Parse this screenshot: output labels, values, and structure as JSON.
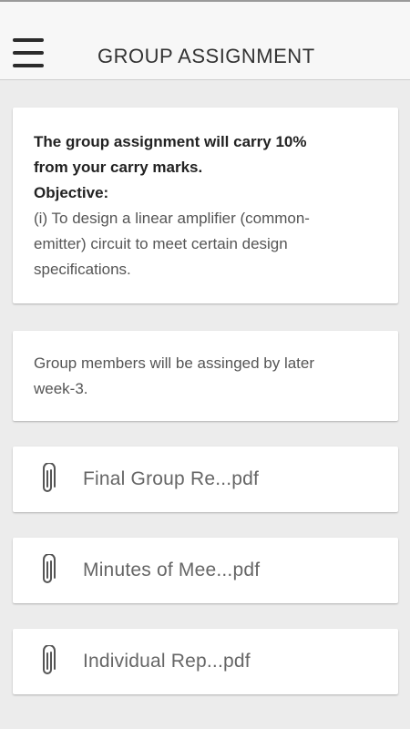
{
  "header": {
    "title": "GROUP ASSIGNMENT",
    "menu_icon": "hamburger-menu-icon"
  },
  "description": {
    "line1": "The group assignment will carry 10%",
    "line2": "from your carry marks.",
    "objective_label": "Objective:",
    "objective_text_line1": "(i) To design a linear amplifier (common-",
    "objective_text_line2": "emitter) circuit to meet certain design",
    "objective_text_line3": "specifications."
  },
  "note": {
    "line1": "Group members will be assinged by later",
    "line2": "week-3."
  },
  "attachments": [
    {
      "label": "Final Group Re...pdf",
      "icon": "paperclip-icon"
    },
    {
      "label": "Minutes of Mee...pdf",
      "icon": "paperclip-icon"
    },
    {
      "label": "Individual Rep...pdf",
      "icon": "paperclip-icon"
    }
  ],
  "colors": {
    "background": "#ececec",
    "app_bar": "#f7f7f7",
    "card": "#ffffff"
  }
}
